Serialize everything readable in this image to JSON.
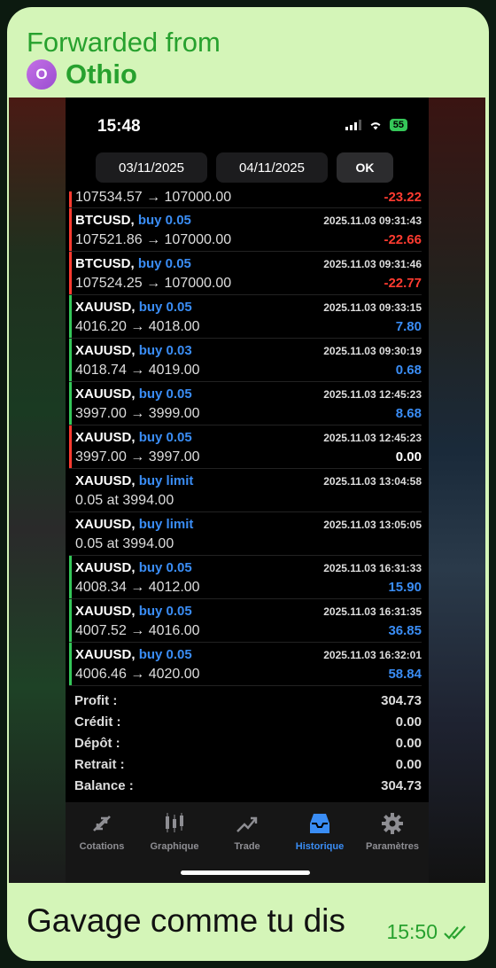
{
  "forward": {
    "header": "Forwarded from",
    "avatar_letter": "O",
    "name": "Othio"
  },
  "phone": {
    "time": "15:48",
    "battery": "55",
    "dates": {
      "from": "03/11/2025",
      "to": "04/11/2025",
      "ok": "OK"
    },
    "partial_row": {
      "prices": "107534.57 → 107000.00",
      "profit": "-23.22",
      "profit_class": "neg",
      "edge": "#ff3b30"
    },
    "trades": [
      {
        "symbol": "BTCUSD,",
        "type": "buy 0.05",
        "time": "2025.11.03 09:31:43",
        "prices": "107521.86 → 107000.00",
        "profit": "-22.66",
        "profit_class": "neg",
        "edge": "#ff3b30"
      },
      {
        "symbol": "BTCUSD,",
        "type": "buy 0.05",
        "time": "2025.11.03 09:31:46",
        "prices": "107524.25 → 107000.00",
        "profit": "-22.77",
        "profit_class": "neg",
        "edge": "#ff3b30"
      },
      {
        "symbol": "XAUUSD,",
        "type": "buy 0.05",
        "time": "2025.11.03 09:33:15",
        "prices": "4016.20 → 4018.00",
        "profit": "7.80",
        "profit_class": "pos",
        "edge": "#34c759"
      },
      {
        "symbol": "XAUUSD,",
        "type": "buy 0.03",
        "time": "2025.11.03 09:30:19",
        "prices": "4018.74 → 4019.00",
        "profit": "0.68",
        "profit_class": "pos",
        "edge": "#34c759"
      },
      {
        "symbol": "XAUUSD,",
        "type": "buy 0.05",
        "time": "2025.11.03 12:45:23",
        "prices": "3997.00 → 3999.00",
        "profit": "8.68",
        "profit_class": "pos",
        "edge": "#34c759"
      },
      {
        "symbol": "XAUUSD,",
        "type": "buy 0.05",
        "time": "2025.11.03 12:45:23",
        "prices": "3997.00 → 3997.00",
        "profit": "0.00",
        "profit_class": "zero",
        "edge": "#ff3b30"
      },
      {
        "symbol": "XAUUSD,",
        "type": "buy limit",
        "time": "2025.11.03 13:04:58",
        "prices": "0.05 at 3994.00",
        "profit": "",
        "profit_class": "zero",
        "edge": "transparent"
      },
      {
        "symbol": "XAUUSD,",
        "type": "buy limit",
        "time": "2025.11.03 13:05:05",
        "prices": "0.05 at 3994.00",
        "profit": "",
        "profit_class": "zero",
        "edge": "transparent"
      },
      {
        "symbol": "XAUUSD,",
        "type": "buy 0.05",
        "time": "2025.11.03 16:31:33",
        "prices": "4008.34 → 4012.00",
        "profit": "15.90",
        "profit_class": "pos",
        "edge": "#34c759"
      },
      {
        "symbol": "XAUUSD,",
        "type": "buy 0.05",
        "time": "2025.11.03 16:31:35",
        "prices": "4007.52 → 4016.00",
        "profit": "36.85",
        "profit_class": "pos",
        "edge": "#34c759"
      },
      {
        "symbol": "XAUUSD,",
        "type": "buy 0.05",
        "time": "2025.11.03 16:32:01",
        "prices": "4006.46 → 4020.00",
        "profit": "58.84",
        "profit_class": "pos",
        "edge": "#34c759"
      }
    ],
    "summary": [
      {
        "label": "Profit :",
        "value": "304.73"
      },
      {
        "label": "Crédit :",
        "value": "0.00"
      },
      {
        "label": "Dépôt :",
        "value": "0.00"
      },
      {
        "label": "Retrait :",
        "value": "0.00"
      },
      {
        "label": "Balance :",
        "value": "304.73"
      }
    ],
    "tabs": [
      {
        "label": "Cotations",
        "icon": "quotes-icon",
        "active": false
      },
      {
        "label": "Graphique",
        "icon": "chart-icon",
        "active": false
      },
      {
        "label": "Trade",
        "icon": "trade-icon",
        "active": false
      },
      {
        "label": "Historique",
        "icon": "history-icon",
        "active": true
      },
      {
        "label": "Paramètres",
        "icon": "gear-icon",
        "active": false
      }
    ]
  },
  "message": {
    "text": "Gavage comme tu dis",
    "time": "15:50",
    "status_icon": "double-check-icon"
  }
}
